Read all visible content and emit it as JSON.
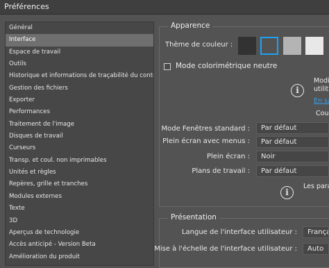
{
  "window": {
    "title": "Préférences"
  },
  "sidebar": {
    "items": [
      {
        "label": "Général"
      },
      {
        "label": "Interface"
      },
      {
        "label": "Espace de travail"
      },
      {
        "label": "Outils"
      },
      {
        "label": "Historique et informations de traçabilité du contenu"
      },
      {
        "label": "Gestion des fichiers"
      },
      {
        "label": "Exporter"
      },
      {
        "label": "Performances"
      },
      {
        "label": "Traitement de l'image"
      },
      {
        "label": "Disques de travail"
      },
      {
        "label": "Curseurs"
      },
      {
        "label": "Transp. et coul. non imprimables"
      },
      {
        "label": "Unités et règles"
      },
      {
        "label": "Repères, grille et tranches"
      },
      {
        "label": "Modules externes"
      },
      {
        "label": "Texte"
      },
      {
        "label": "3D"
      },
      {
        "label": "Aperçus de technologie"
      },
      {
        "label": "Accès anticipé - Version Beta"
      },
      {
        "label": "Amélioration du produit"
      }
    ],
    "selected": "Interface"
  },
  "apparence": {
    "title": "Apparence",
    "theme_label": "Thème de couleur :",
    "swatch_colors": [
      "#323232",
      "#525252",
      "#b4b4b4",
      "#e8e8e8"
    ],
    "selected_swatch_color": "#1ea1f2",
    "checkbox_label": "Mode colorimétrique neutre",
    "checkbox_checked": false,
    "info_text_1": "Modi",
    "info_text_2": "utilita",
    "link_text": "En sa",
    "info_text_3": "Cou",
    "rows": [
      {
        "label": "Mode Fenêtres standard :",
        "value": "Par défaut"
      },
      {
        "label": "Plein écran avec menus :",
        "value": "Par défaut"
      },
      {
        "label": "Plein écran :",
        "value": "Noir"
      },
      {
        "label": "Plans de travail :",
        "value": "Par défaut"
      }
    ],
    "bottom_info_text": "Les para"
  },
  "presentation": {
    "title": "Présentation",
    "language_label": "Langue de l'interface utilisateur :",
    "language_value": "Françai",
    "scale_label": "Mise à l'échelle de l'interface utilisateur :",
    "scale_value": "Auto"
  },
  "icons": {
    "info": "info-circle-icon"
  }
}
